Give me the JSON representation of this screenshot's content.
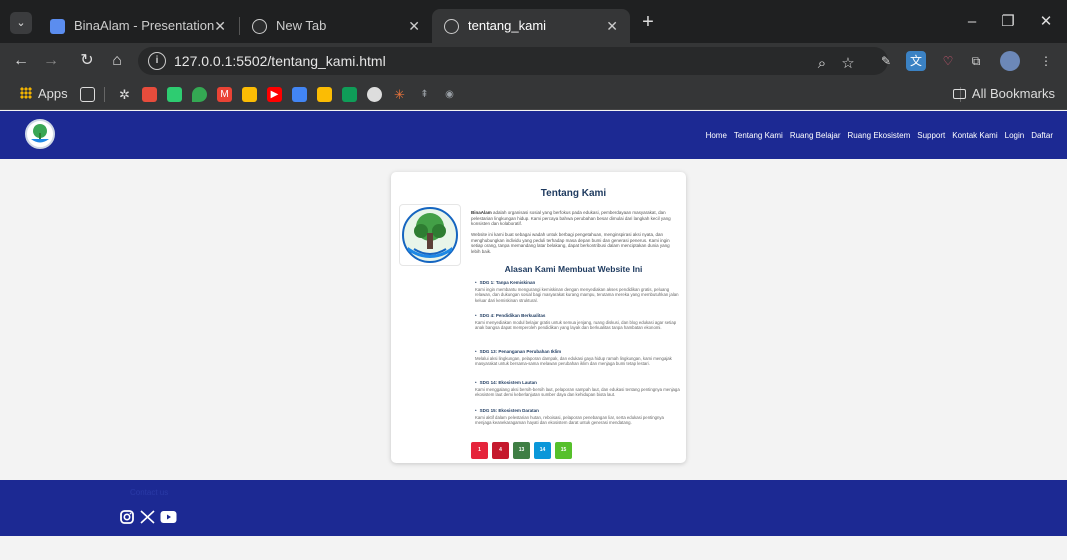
{
  "browser": {
    "tabs": [
      {
        "title": "BinaAlam - Presentation",
        "icon_color": "#5b8def"
      },
      {
        "title": "New Tab",
        "icon_color": "#9aa0a6"
      },
      {
        "title": "tentang_kami",
        "icon_color": "#9aa0a6"
      }
    ],
    "url": "127.0.0.1:5502/tentang_kami.html",
    "bookmarks": {
      "apps_label": "Apps",
      "all_label": "All Bookmarks"
    }
  },
  "site": {
    "brand_color": "#1c2993",
    "nav": [
      "Home",
      "Tentang Kami",
      "Ruang Belajar",
      "Ruang Ekosistem",
      "Support",
      "Kontak Kami",
      "Login",
      "Daftar"
    ],
    "about": {
      "title": "Tentang Kami",
      "intro_brand": "BinaAlam",
      "intro": "adalah organisasi sosial yang berfokus pada edukasi, pemberdayaan masyarakat, dan pelestarian lingkungan hidup. Kami percaya bahwa perubahan besar dimulai dari langkah kecil yang konsisten dan kolaboratif.",
      "mission": "Website ini kami buat sebagai wadah untuk berbagi pengetahuan, menginspirasi aksi nyata, dan menghubungkan individu yang peduli terhadap masa depan bumi dan generasi penerus. Kami ingin setiap orang, tanpa memandang latar belakang, dapat berkontribusi dalam menciptakan dunia yang lebih baik.",
      "reasons_title": "Alasan Kami Membuat Website Ini",
      "sdgs": [
        {
          "title": "SDG 1: Tanpa Kemiskinan",
          "text": "Kami ingin membantu mengurangi kemiskinan dengan menyediakan akses pendidikan gratis, peluang relawan, dan dukungan sosial bagi masyarakat kurang mampu, terutama mereka yang membutuhkan jalan keluar dari kemiskinan struktural."
        },
        {
          "title": "SDG 4: Pendidikan Berkualitas",
          "text": "Kami menyediakan modul belajar gratis untuk semua jenjang, ruang diskusi, dan blog edukasi agar setiap anak bangsa dapat memperoleh pendidikan yang layak dan berkualitas tanpa hambatan ekonomi."
        },
        {
          "title": "SDG 13: Penanganan Perubahan Iklim",
          "text": "Melalui aksi lingkungan, pelaporan dampak, dan edukasi gaya hidup ramah lingkungan, kami mengajak masyarakat untuk bersama-sama melawan perubahan iklim dan menjaga bumi tetap lestari."
        },
        {
          "title": "SDG 14: Ekosistem Lautan",
          "text": "Kami menggalang aksi bersih-bersih laut, pelaporan sampah laut, dan edukasi tentang pentingnya menjaga ekosistem laut demi keberlanjutan sumber daya dan kehidupan biota laut."
        },
        {
          "title": "SDG 15: Ekosistem Daratan",
          "text": "Kami aktif dalam pelestarian hutan, reboisasi, pelaporan penebangan liar, serta edukasi pentingnya menjaga keanekaragaman hayati dan ekosistem darat untuk generasi mendatang."
        }
      ],
      "sdg_icons": [
        {
          "label": "1",
          "color": "#e5243b"
        },
        {
          "label": "4",
          "color": "#c5192d"
        },
        {
          "label": "13",
          "color": "#3f7e44"
        },
        {
          "label": "14",
          "color": "#0a97d9"
        },
        {
          "label": "15",
          "color": "#56c02b"
        }
      ]
    },
    "footer": {
      "contact_label": "Contact us"
    }
  }
}
